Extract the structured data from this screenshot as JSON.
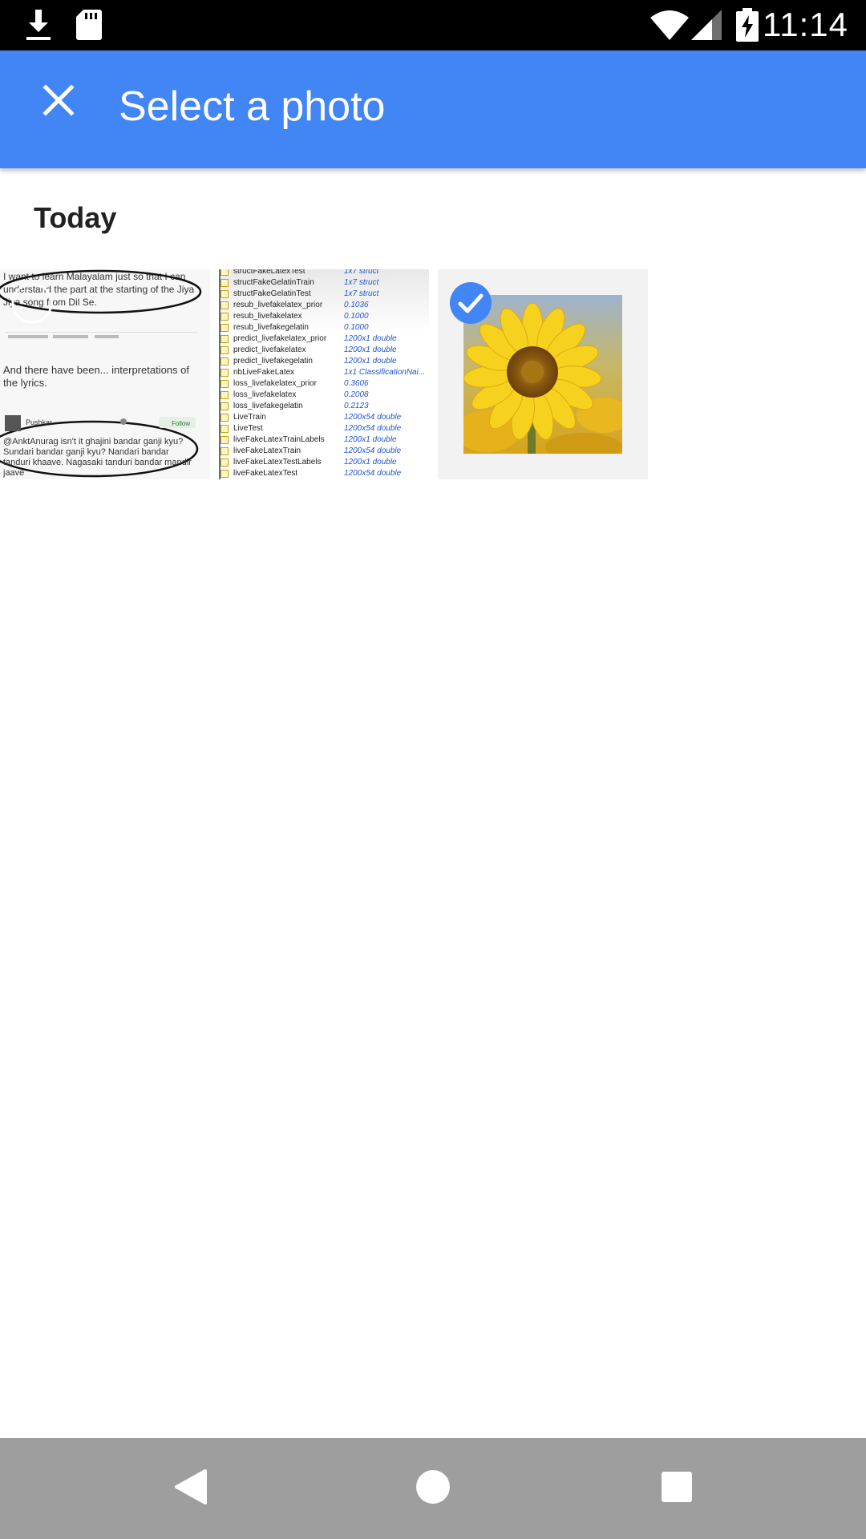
{
  "status_bar": {
    "time": "11:14",
    "icons": [
      "download-icon",
      "sd-card-icon",
      "wifi-icon",
      "cell-signal-icon",
      "battery-charging-icon"
    ]
  },
  "app_bar": {
    "title": "Select a photo",
    "close_icon": "close-icon",
    "background_color": "#4285f4"
  },
  "section": {
    "header": "Today"
  },
  "photos": [
    {
      "selected": false,
      "lines": [
        "I want to learn Malayalam just so that I can",
        "understand the part at the starting of the Jiya",
        "Jiya song from Dil Se.",
        "And there have been... interpretations of",
        "the lyrics.",
        "Pushkar",
        "Follow",
        "@AnktAnurag isn't it ghajini bandar ganji kyu?",
        "Sundari bandar ganji kyu? Nandari bandar",
        "tanduri khaave. Nagasaki tanduri bandar mandir",
        "jaave"
      ]
    },
    {
      "selected": false,
      "rows": [
        {
          "name": "structFakeLatexTest",
          "value": "1x7 struct"
        },
        {
          "name": "structFakeGelatinTrain",
          "value": "1x7 struct"
        },
        {
          "name": "structFakeGelatinTest",
          "value": "1x7 struct"
        },
        {
          "name": "resub_livefakelatex_prior",
          "value": "0.1036"
        },
        {
          "name": "resub_livefakelatex",
          "value": "0.1000"
        },
        {
          "name": "resub_livefakegelatin",
          "value": "0.1000"
        },
        {
          "name": "predict_livefakelatex_prior",
          "value": "1200x1 double"
        },
        {
          "name": "predict_livefakelatex",
          "value": "1200x1 double"
        },
        {
          "name": "predict_livefakegelatin",
          "value": "1200x1 double"
        },
        {
          "name": "nbLiveFakeLatex",
          "value": "1x1 ClassificationNai..."
        },
        {
          "name": "loss_livefakelatex_prior",
          "value": "0.3606"
        },
        {
          "name": "loss_livefakelatex",
          "value": "0.2008"
        },
        {
          "name": "loss_livefakegelatin",
          "value": "0.2123"
        },
        {
          "name": "LiveTrain",
          "value": "1200x54 double"
        },
        {
          "name": "LiveTest",
          "value": "1200x54 double"
        },
        {
          "name": "liveFakeLatexTrainLabels",
          "value": "1200x1 double"
        },
        {
          "name": "liveFakeLatexTrain",
          "value": "1200x54 double"
        },
        {
          "name": "liveFakeLatexTestLabels",
          "value": "1200x1 double"
        },
        {
          "name": "liveFakeLatexTest",
          "value": "1200x54 double"
        }
      ]
    },
    {
      "selected": true,
      "subject": "sunflower"
    }
  ],
  "nav_bar": {
    "back_icon": "back-icon",
    "home_icon": "home-icon",
    "recents_icon": "recents-icon"
  },
  "colors": {
    "accent": "#4285f4",
    "status_bar": "#000000",
    "nav_bar": "#9e9e9e"
  }
}
